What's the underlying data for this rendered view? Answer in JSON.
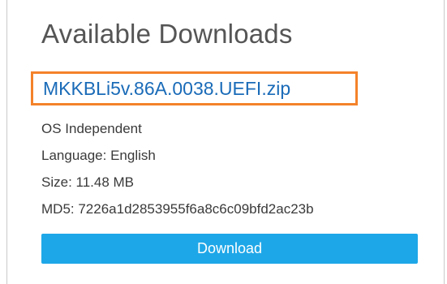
{
  "section": {
    "title": "Available Downloads"
  },
  "file": {
    "name": "MKKBLi5v.86A.0038.UEFI.zip",
    "os": "OS Independent",
    "language": "Language: English",
    "size": "Size: 11.48 MB",
    "md5": "MD5: 7226a1d2853955f6a8c6c09bfd2ac23b"
  },
  "actions": {
    "download_label": "Download"
  },
  "colors": {
    "link": "#1a6bb8",
    "highlight": "#f4822a",
    "button": "#1ea7e8"
  }
}
